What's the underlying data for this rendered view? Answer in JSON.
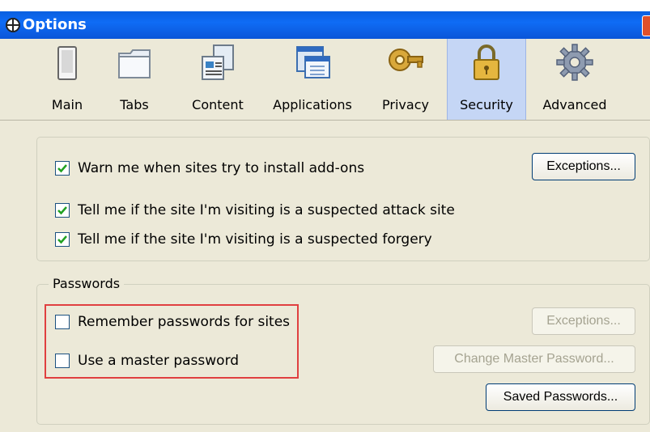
{
  "window": {
    "title": "Options"
  },
  "toolbar": {
    "items": [
      {
        "label": "Main",
        "icon": "main-icon"
      },
      {
        "label": "Tabs",
        "icon": "tabs-icon"
      },
      {
        "label": "Content",
        "icon": "content-icon"
      },
      {
        "label": "Applications",
        "icon": "applications-icon"
      },
      {
        "label": "Privacy",
        "icon": "privacy-icon"
      },
      {
        "label": "Security",
        "icon": "security-icon",
        "selected": true
      },
      {
        "label": "Advanced",
        "icon": "advanced-icon"
      }
    ]
  },
  "security": {
    "warn_addons": {
      "label": "Warn me when sites try to install add-ons",
      "checked": true
    },
    "exceptions_button": "Exceptions...",
    "attack_site": {
      "label": "Tell me if the site I'm visiting is a suspected attack site",
      "checked": true
    },
    "forgery": {
      "label": "Tell me if the site I'm visiting is a suspected forgery",
      "checked": true
    }
  },
  "passwords": {
    "legend": "Passwords",
    "remember": {
      "label": "Remember passwords for sites",
      "checked": false
    },
    "master": {
      "label": "Use a master password",
      "checked": false
    },
    "exceptions_button": "Exceptions...",
    "change_master_button": "Change Master Password...",
    "saved_passwords_button": "Saved Passwords..."
  },
  "colors": {
    "titlebar": "#0a5fe0",
    "selected_tab": "#c5d6f5",
    "highlight": "#e04040",
    "panel": "#ece9d8"
  }
}
